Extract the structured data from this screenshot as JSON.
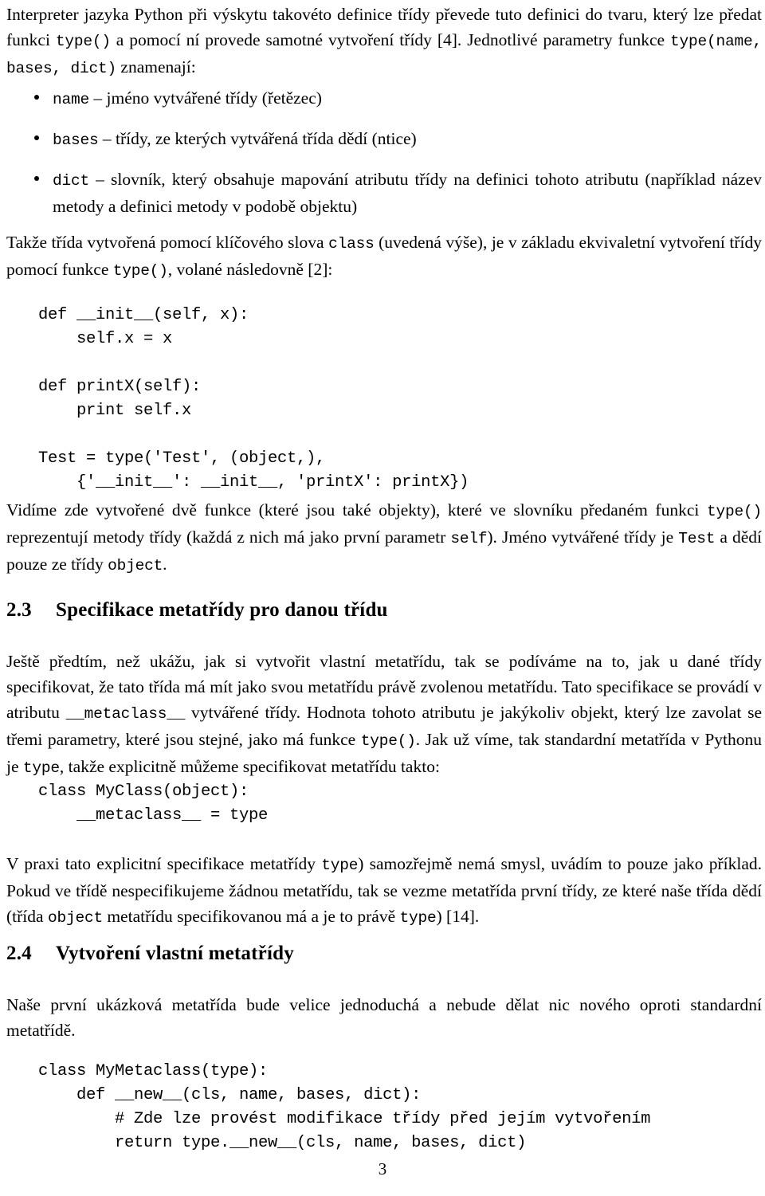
{
  "document": {
    "page_number": "3",
    "language": "cs"
  },
  "intro": {
    "paragraph_parts": [
      "Interpreter jazyka Python při výskytu takovéto definice třídy převede tuto definici do tvaru, který lze předat funkci ",
      "type()",
      " a pomocí ní provede samotné vytvoření třídy [4]. Jednotlivé parametry funkce ",
      "type(name, bases, dict)",
      " znamenají:"
    ]
  },
  "params_list": {
    "items": [
      {
        "term": "name",
        "description": " – jméno vytvářené třídy (řetězec)"
      },
      {
        "term": "bases",
        "description": " – třídy, ze kterých vytvářená třída dědí (ntice)"
      },
      {
        "term": "dict",
        "description": " – slovník, který obsahuje mapování atributu třídy na definici tohoto atributu (například název metody a definici metody v podobě objektu)"
      }
    ]
  },
  "equivalence_paragraph": {
    "parts": [
      "Takže třída vytvořená pomocí klíčového slova ",
      "class",
      " (uvedená výše), je v základu ekvivaletní vytvoření třídy pomocí funkce ",
      "type()",
      ", volané následovně [2]:"
    ]
  },
  "code_blocks": {
    "type_call_example": "def __init__(self, x):\n    self.x = x\n\ndef printX(self):\n    print self.x\n\nTest = type('Test', (object,),\n    {'__init__': __init__, 'printX': printX})",
    "metaclass_attribute_example": "class MyClass(object):\n    __metaclass__ = type",
    "my_metaclass_example": "class MyMetaclass(type):\n    def __new__(cls, name, bases, dict):\n        # Zde lze provést modifikace třídy před jejím vytvořením\n        return type.__new__(cls, name, bases, dict)"
  },
  "explanation_paragraph": {
    "parts": [
      "Vidíme zde vytvořené dvě funkce (které jsou také objekty), které ve slovníku předaném funkci ",
      "type()",
      " reprezentují metody třídy (každá z nich má jako první parametr ",
      "self",
      "). Jméno vytvářené třídy je ",
      "Test",
      " a dědí pouze ze třídy ",
      "object",
      "."
    ]
  },
  "section_2_3": {
    "number": "2.3",
    "title": "Specifikace metatřídy pro danou třídu",
    "paragraph_parts": [
      "Ještě předtím, než ukážu, jak si vytvořit vlastní metatřídu, tak se podíváme na to, jak u dané třídy specifikovat, že tato třída má mít jako svou metatřídu právě zvolenou metatřídu. Tato specifikace se provádí v atributu ",
      "__metaclass__",
      " vytvářené třídy. Hodnota tohoto atributu je jakýkoliv objekt, který lze zavolat se třemi parametry, které jsou stejné, jako má funkce ",
      "type()",
      ". Jak už víme, tak standardní metatřída v Pythonu je ",
      "type",
      ", takže explicitně můžeme specifikovat metatřídu takto:"
    ],
    "after_code_paragraph_parts": [
      "V praxi tato explicitní specifikace metatřídy ",
      "type",
      ") samozřejmě nemá smysl, uvádím to pouze jako příklad. Pokud ve třídě nespecifikujeme žádnou metatřídu, tak se vezme metatřída první třídy, ze které naše třída dědí (třída ",
      "object",
      " metatřídu specifikovanou má a je to právě ",
      "type",
      ") [14]."
    ]
  },
  "section_2_4": {
    "number": "2.4",
    "title": "Vytvoření vlastní metatřídy",
    "paragraph": "Naše první ukázková metatřída bude velice jednoduchá a nebude dělat nic nového oproti standardní metatřídě."
  },
  "colors": {
    "text": "#000000",
    "background": "#ffffff"
  }
}
